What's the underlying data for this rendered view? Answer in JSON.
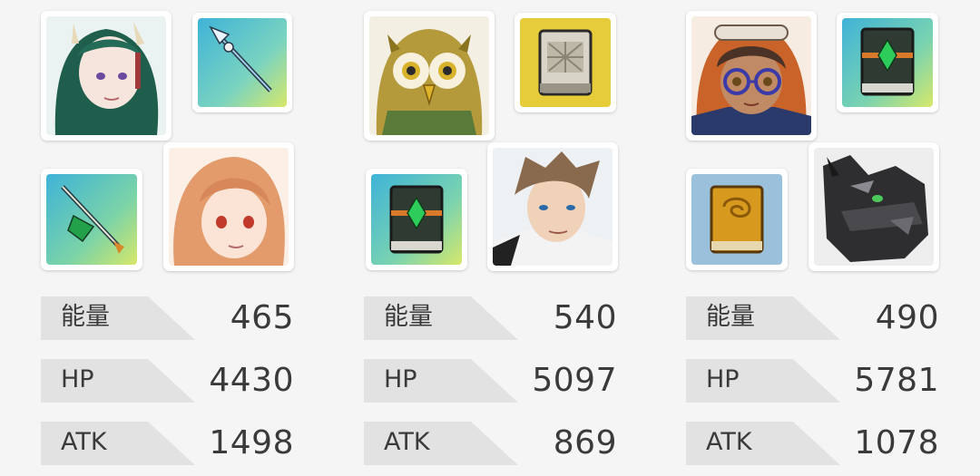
{
  "teams": [
    {
      "hero1_icon": "green-haired-horned-woman-portrait",
      "weapon1_icon": "blue-lance-icon",
      "weapon2_icon": "green-lance-icon",
      "hero2_icon": "orange-haired-woman-portrait",
      "stats": [
        {
          "label": "能量",
          "value": "465"
        },
        {
          "label": "HP",
          "value": "4430"
        },
        {
          "label": "ATK",
          "value": "1498"
        }
      ]
    },
    {
      "hero1_icon": "owl-portrait",
      "weapon1_icon": "gray-tome-icon",
      "weapon2_icon": "green-gem-tome-icon",
      "hero2_icon": "brown-haired-man-portrait",
      "stats": [
        {
          "label": "能量",
          "value": "540"
        },
        {
          "label": "HP",
          "value": "5097"
        },
        {
          "label": "ATK",
          "value": "869"
        }
      ]
    },
    {
      "hero1_icon": "goggles-child-portrait",
      "weapon1_icon": "green-gem-tome-icon",
      "weapon2_icon": "gold-tome-icon",
      "hero2_icon": "black-wolf-dragon-portrait",
      "stats": [
        {
          "label": "能量",
          "value": "490"
        },
        {
          "label": "HP",
          "value": "5781"
        },
        {
          "label": "ATK",
          "value": "1078"
        }
      ]
    }
  ]
}
